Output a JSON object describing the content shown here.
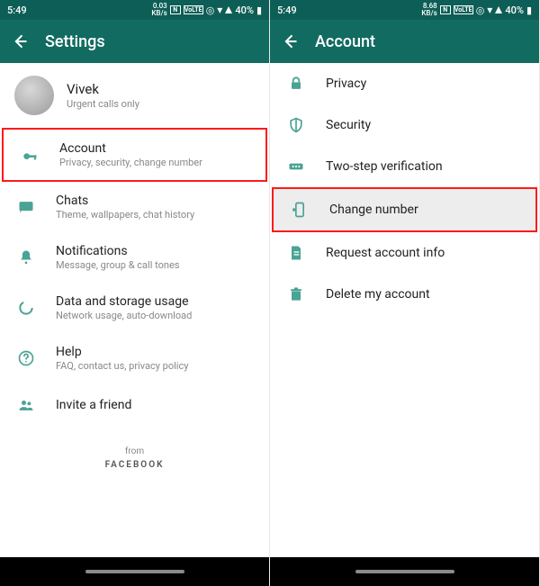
{
  "status": {
    "time": "5:49",
    "kb_left": "0.03",
    "kb_right": "8.68",
    "kb_unit": "KB/s",
    "volte": "VoLTE",
    "battery": "40%"
  },
  "left": {
    "header": "Settings",
    "profile": {
      "name": "Vivek",
      "status": "Urgent calls only"
    },
    "items": {
      "account": {
        "title": "Account",
        "sub": "Privacy, security, change number"
      },
      "chats": {
        "title": "Chats",
        "sub": "Theme, wallpapers, chat history"
      },
      "notif": {
        "title": "Notifications",
        "sub": "Message, group & call tones"
      },
      "data": {
        "title": "Data and storage usage",
        "sub": "Network usage, auto-download"
      },
      "help": {
        "title": "Help",
        "sub": "FAQ, contact us, privacy policy"
      },
      "invite": {
        "title": "Invite a friend"
      }
    },
    "footer_from": "from",
    "footer_fb": "FACEBOOK"
  },
  "right": {
    "header": "Account",
    "items": {
      "privacy": {
        "title": "Privacy"
      },
      "security": {
        "title": "Security"
      },
      "twostep": {
        "title": "Two-step verification"
      },
      "change": {
        "title": "Change number"
      },
      "request": {
        "title": "Request account info"
      },
      "delete": {
        "title": "Delete my account"
      }
    }
  }
}
